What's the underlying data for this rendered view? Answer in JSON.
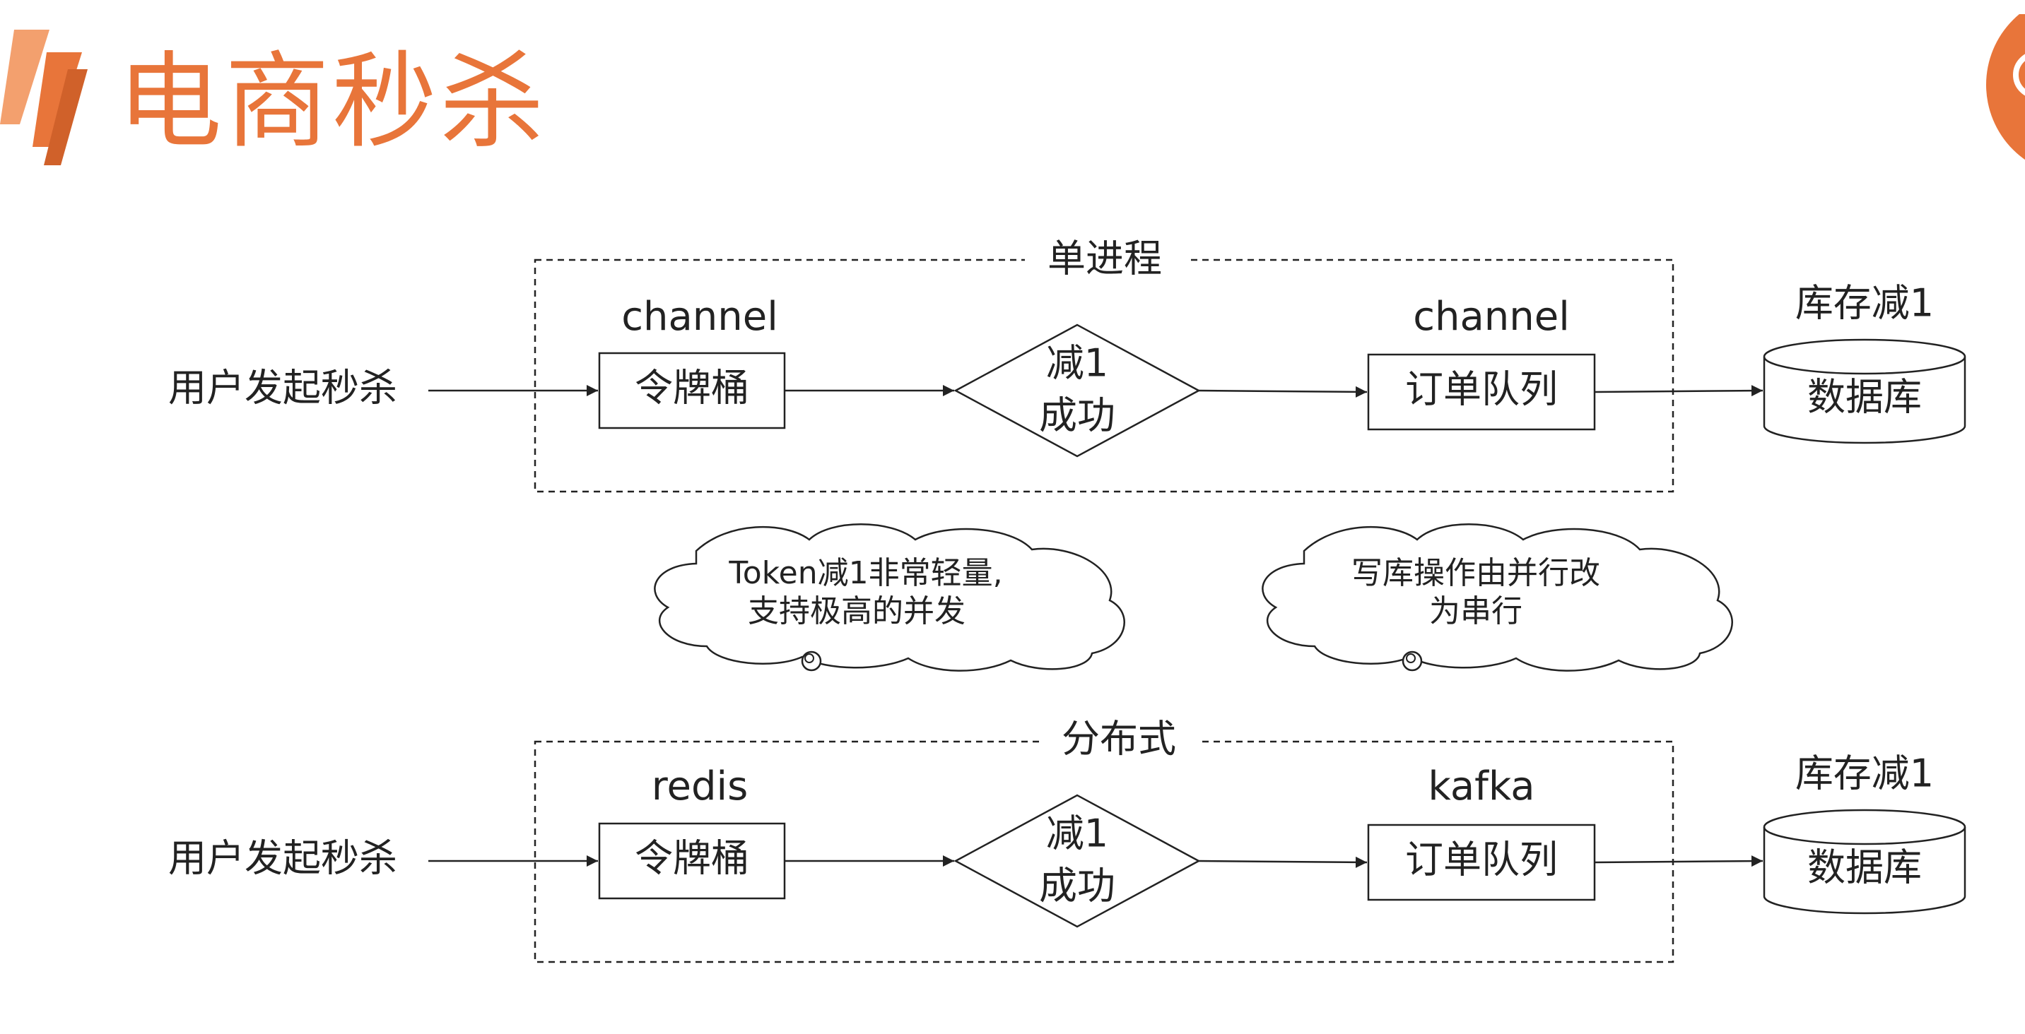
{
  "title": "电商秒杀",
  "colors": {
    "accent": "#e8753a",
    "accent_light": "#f3a06e",
    "stroke": "#222222"
  },
  "single_process": {
    "label": "单进程",
    "source": "用户发起秒杀",
    "bucket_caption": "channel",
    "bucket": "令牌桶",
    "decision_line1": "减1",
    "decision_line2": "成功",
    "queue_caption": "channel",
    "queue": "订单队列",
    "db_caption": "库存减1",
    "db": "数据库"
  },
  "distributed": {
    "label": "分布式",
    "source": "用户发起秒杀",
    "bucket_caption": "redis",
    "bucket": "令牌桶",
    "decision_line1": "减1",
    "decision_line2": "成功",
    "queue_caption": "kafka",
    "queue": "订单队列",
    "db_caption": "库存减1",
    "db": "数据库"
  },
  "notes": {
    "token_line1": "Token减1非常轻量,",
    "token_line2": "支持极高的并发",
    "serial_line1": "写库操作由并行改",
    "serial_line2": "为串行"
  }
}
